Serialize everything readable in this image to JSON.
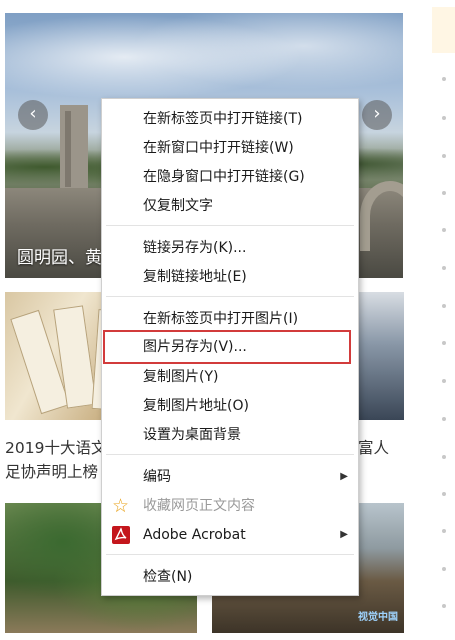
{
  "page": {
    "hero_caption": "圆明园、黄",
    "hero_prev_icon": "‹",
    "hero_next_icon": "›",
    "news_left_line1": "2019十大语文",
    "news_left_line2": "足协声明上榜",
    "news_right_line1": "富人",
    "thumb_watermark": "视觉中国"
  },
  "context_menu": {
    "items": [
      {
        "label": "在新标签页中打开链接(T)"
      },
      {
        "label": "在新窗口中打开链接(W)"
      },
      {
        "label": "在隐身窗口中打开链接(G)"
      },
      {
        "label": "仅复制文字"
      },
      {
        "label": "链接另存为(K)..."
      },
      {
        "label": "复制链接地址(E)"
      },
      {
        "label": "在新标签页中打开图片(I)"
      },
      {
        "label": "图片另存为(V)..."
      },
      {
        "label": "复制图片(Y)"
      },
      {
        "label": "复制图片地址(O)"
      },
      {
        "label": "设置为桌面背景"
      },
      {
        "label": "编码",
        "submenu": "▶"
      },
      {
        "label": "收藏网页正文内容"
      },
      {
        "label": "Adobe Acrobat",
        "submenu": "▶"
      },
      {
        "label": "检查(N)"
      }
    ],
    "highlighted_item": "图片另存为(V)...",
    "highlight_color": "#d23b3b",
    "star_icon_glyph": "☆"
  },
  "colors": {
    "star_icon": "#e8a21a",
    "acrobat_icon": "#c4161c",
    "disabled_text": "#9a9a9a"
  }
}
